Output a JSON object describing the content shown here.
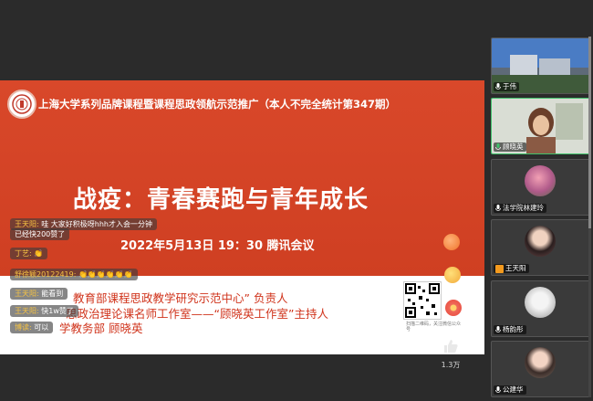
{
  "slide": {
    "header": "上海大学系列品牌课程暨课程思政领航示范推广（本人不完全统计第347期）",
    "title": "战疫：青春赛跑与青年成长",
    "datetime": "2022年5月13日 19：30  腾讯会议",
    "presenter_lines": [
      "教育部课程思政教学研究示范中心” 负责人",
      "思政治理论课名师工作室——“顾晓英工作室”主持人",
      "学教务部  顾晓英"
    ],
    "qr_caption": "扫描二维码，关注微信公众号"
  },
  "chat": [
    {
      "author": "王天阳:",
      "text": "哇 大家好积极呀hhh才入会一分钟"
    },
    {
      "author": "",
      "text": "已经快200赞了"
    },
    {
      "author": "丁艺:",
      "text": "👏"
    },
    {
      "author": "舒徐颖20122419:",
      "text": "👏👏👏👏👏👏"
    },
    {
      "author": "王天阳:",
      "text": "能看到"
    },
    {
      "author": "王天阳:",
      "text": "快1w赞了"
    },
    {
      "author": "博读:",
      "text": "可以"
    }
  ],
  "reactions": {
    "like_count": "1.3万"
  },
  "participants": [
    {
      "name": "于伟",
      "mic": "on",
      "active": false
    },
    {
      "name": "顾晓英",
      "mic": "on",
      "active": true
    },
    {
      "name": "法学院林建玲",
      "mic": "on",
      "active": false
    },
    {
      "name": "王天阳",
      "mic": "hand",
      "active": false
    },
    {
      "name": "杨韵彤",
      "mic": "on",
      "active": false
    },
    {
      "name": "公建华",
      "mic": "on",
      "active": false
    }
  ],
  "colors": {
    "slide_red": "#d9482a",
    "presenter_text": "#d0341c",
    "chat_author": "#f6c343",
    "active_border": "#3fc16a"
  }
}
